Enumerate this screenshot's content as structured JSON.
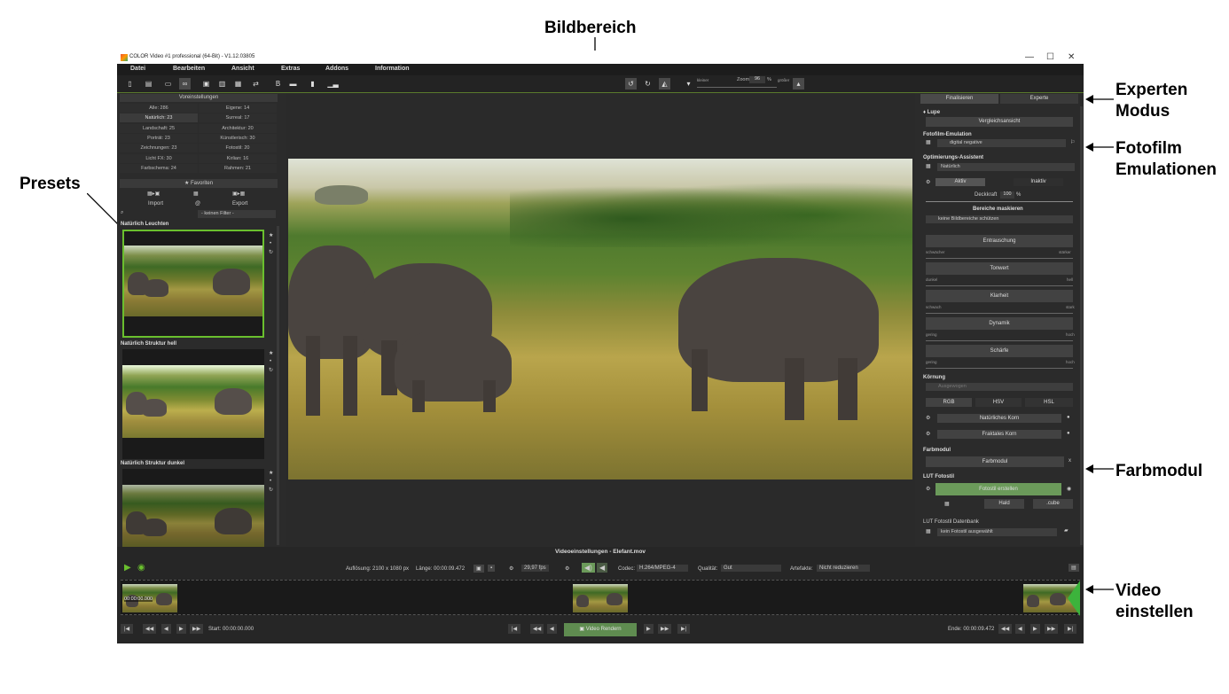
{
  "annotations": {
    "bildbereich": "Bildbereich",
    "experten": [
      "Experten",
      "Modus"
    ],
    "fotofilm": [
      "Fotofilm",
      "Emulationen"
    ],
    "presets": "Presets",
    "farbmodul": "Farbmodul",
    "video": [
      "Video",
      "einstellen"
    ]
  },
  "window": {
    "title": "COLOR Video #1 professional (64-Bit) - V1.12.03805",
    "minimize": "—",
    "maximize": "☐",
    "close": "✕"
  },
  "menu": [
    "Datei",
    "Bearbeiten",
    "Ansicht",
    "Extras",
    "Addons",
    "Information"
  ],
  "toolbar": {
    "zoom_label": "Zoom",
    "zoom_value": "96",
    "zoom_unit": "%",
    "smaller": "kleiner",
    "bigger": "größer"
  },
  "left": {
    "header": "Voreinstellungen",
    "categories": [
      [
        "Alle: 286",
        "Eigene: 14"
      ],
      [
        "Natürlich: 23",
        "Surreal: 17"
      ],
      [
        "Landschaft: 25",
        "Architektur: 20"
      ],
      [
        "Porträt: 23",
        "Künstlerisch: 30"
      ],
      [
        "Zeichnungen: 23",
        "Fotostil: 20"
      ],
      [
        "Licht FX: 30",
        "Kirlian: 16"
      ],
      [
        "Farbschema: 24",
        "Rahmen: 21"
      ]
    ],
    "favorites": "★ Favoriten",
    "import": "Import",
    "at": "@",
    "export": "Export",
    "filter": "- keinen Filter -",
    "presets": [
      "Natürlich Leuchten",
      "Natürlich Struktur hell",
      "Natürlich Struktur dunkel"
    ]
  },
  "right": {
    "tabs": [
      "Finalisieren",
      "Experte"
    ],
    "lupe": "♦ Lupe",
    "compare": "Vergleichsansicht",
    "fotofilm_title": "Fotofilm-Emulation",
    "fotofilm_value": "digital negative",
    "optimize_title": "Optimierungs-Assistent",
    "optimize_value": "Natürlich",
    "active": "Aktiv",
    "inactive": "Inaktiv",
    "opacity_label": "Deckkraft",
    "opacity_value": "100",
    "opacity_unit": "%",
    "mask_title": "Bereiche maskieren",
    "mask_value": "keine Bildbereiche schützen",
    "adjustments": [
      {
        "label": "Entrauschung",
        "low": "schwächer",
        "high": "stärker"
      },
      {
        "label": "Tonwert",
        "low": "dunkel",
        "high": "hell"
      },
      {
        "label": "Klarheit",
        "low": "schwach",
        "high": "stark"
      },
      {
        "label": "Dynamik",
        "low": "gering",
        "high": "hoch"
      },
      {
        "label": "Schärfe",
        "low": "gering",
        "high": "hoch"
      }
    ],
    "grain_title": "Körnung",
    "grain_value": "Ausgewogen",
    "rgb": "RGB",
    "hsv": "HSV",
    "hsl": "HSL",
    "natural_grain": "Natürliches Korn",
    "fractal_grain": "Fraktales Korn",
    "farbmodul_title": "Farbmodul",
    "farbmodul_btn": "Farbmodul",
    "lut_title": "LUT Fotostil",
    "lut_btn": "Fotostil erstellen",
    "hald": "Hald",
    "cube": ".cube",
    "lut_db": "LUT Fotostil Datenbank",
    "lut_db_value": "kein Fotostil ausgewählt"
  },
  "bottom": {
    "title": "Videoeinstellungen - Elefant.mov",
    "resolution": "Auflösung: 2100 x 1080 px",
    "length": "Länge: 00:00:09.472",
    "fps": "29,97 fps",
    "codec_label": "Codec:",
    "codec_value": "H.264/MPEG-4",
    "quality_label": "Qualität:",
    "quality_value": "Gut",
    "artifacts_label": "Artefakte:",
    "artifacts_value": "Nicht reduzieren",
    "timecode": "00:00:00.000",
    "start": "Start: 00:00:00.000",
    "render": "Video Rendern",
    "end": "Ende: 00:00:09.472"
  }
}
